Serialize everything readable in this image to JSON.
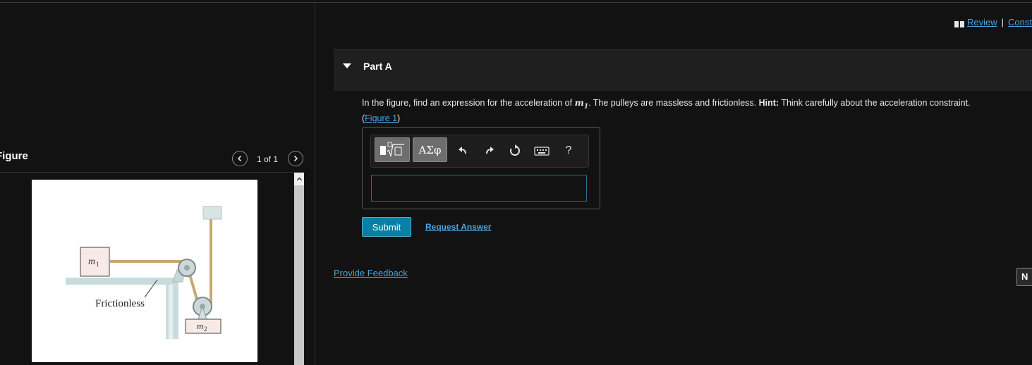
{
  "header": {
    "review_label": "Review",
    "separator": "|",
    "constants_label": "Const"
  },
  "figure_panel": {
    "title": "Figure",
    "pager": "1 of 1",
    "diagram": {
      "mass1_label": "m",
      "mass1_sub": "1",
      "mass2_label": "m",
      "mass2_sub": "2",
      "surface_label": "Frictionless"
    }
  },
  "part": {
    "title": "Part A",
    "question_lead": "In the figure, find an expression for the acceleration of ",
    "question_var": "m",
    "question_var_sub": "1",
    "question_mid": ". The pulleys are massless and frictionless. ",
    "hint_label": "Hint:",
    "hint_text": " Think carefully about the acceleration constraint.",
    "figure_ref_open": "(",
    "figure_ref_link": "Figure 1",
    "figure_ref_close": ")"
  },
  "toolbar": {
    "symbols_label": "ΑΣφ",
    "help_label": "?",
    "icons": [
      "templates-icon",
      "undo-icon",
      "redo-icon",
      "reset-icon",
      "keyboard-icon",
      "help-icon"
    ]
  },
  "answer": {
    "value": ""
  },
  "actions": {
    "submit_label": "Submit",
    "request_answer_label": "Request Answer",
    "feedback_label": "Provide Feedback",
    "next_label": "N"
  },
  "colors": {
    "accent": "#4aa3df",
    "submit": "#0a7ea4",
    "background": "#121212"
  }
}
